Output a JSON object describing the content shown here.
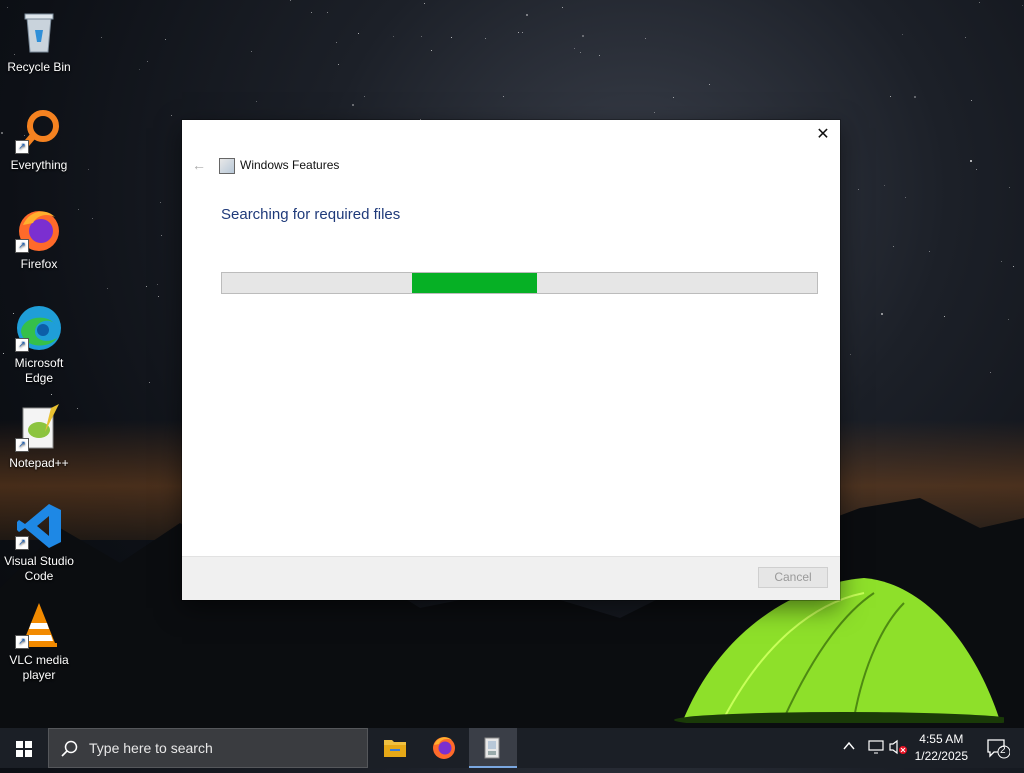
{
  "desktop": {
    "icons": [
      {
        "label": "Recycle Bin",
        "icon": "recycle-bin-icon"
      },
      {
        "label": "Everything",
        "icon": "everything-search-icon"
      },
      {
        "label": "Firefox",
        "icon": "firefox-icon"
      },
      {
        "label": "Microsoft Edge",
        "icon": "edge-icon"
      },
      {
        "label": "Notepad++",
        "icon": "notepadpp-icon"
      },
      {
        "label": "Visual Studio Code",
        "icon": "vscode-icon"
      },
      {
        "label": "VLC media player",
        "icon": "vlc-icon"
      }
    ]
  },
  "dialog": {
    "title": "Windows Features",
    "heading": "Searching for required files",
    "progress": {
      "start": 0.32,
      "end": 0.53
    },
    "cancel_label": "Cancel",
    "close_glyph": "✕",
    "back_glyph": "←",
    "progress_color": "#06b025"
  },
  "taskbar": {
    "search_placeholder": "Type here to search",
    "apps": [
      {
        "name": "File Explorer",
        "icon": "file-explorer-icon"
      },
      {
        "name": "Firefox",
        "icon": "firefox-icon"
      },
      {
        "name": "Windows Features",
        "icon": "windows-features-icon",
        "active": true
      }
    ],
    "time": "4:55 AM",
    "date": "1/22/2025",
    "notification_count": "2"
  }
}
